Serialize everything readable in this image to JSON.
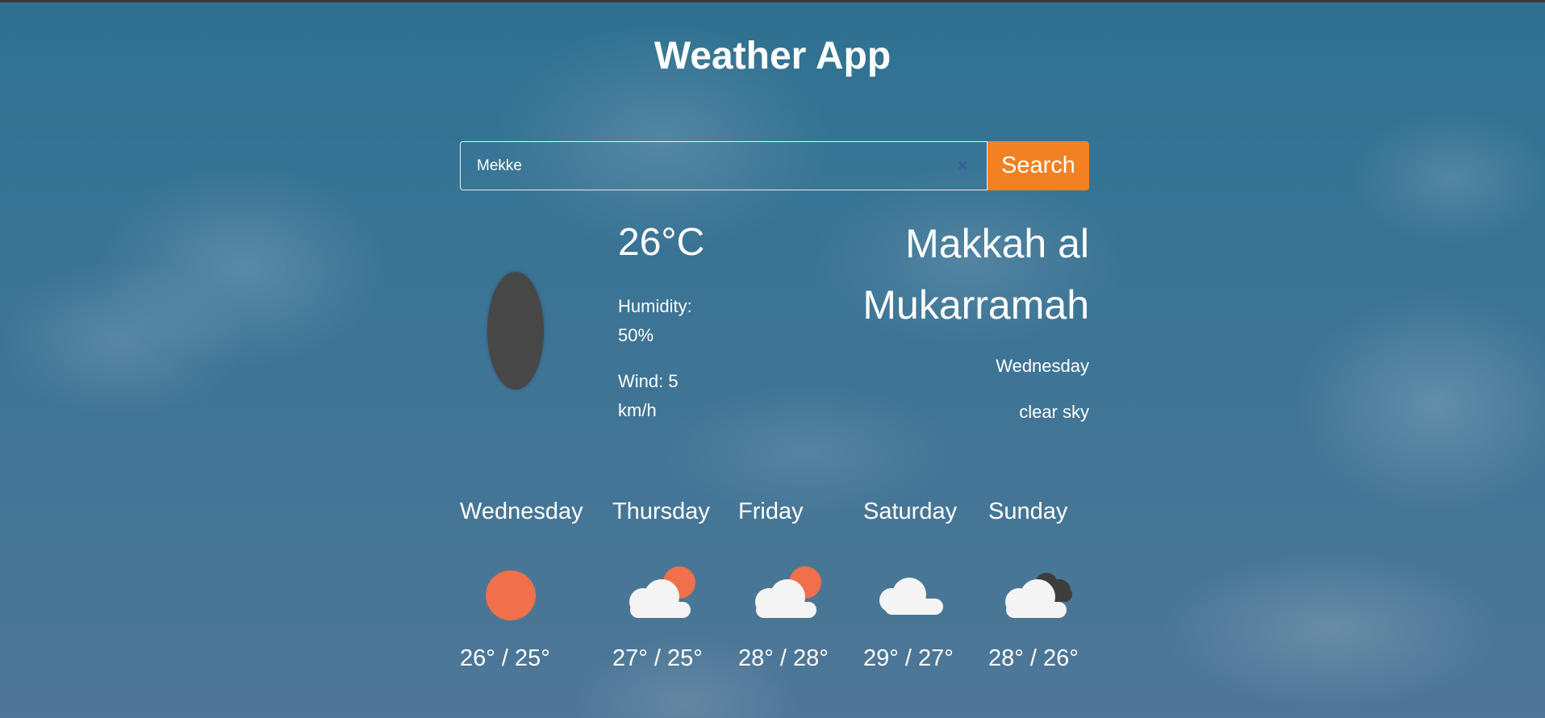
{
  "app": {
    "title": "Weather App"
  },
  "search": {
    "value": "Mekke",
    "button_label": "Search"
  },
  "current": {
    "temperature": "26°C",
    "humidity_label": "Humidity:",
    "humidity_value": "50%",
    "wind_label": "Wind: 5",
    "wind_unit": "km/h",
    "city_line1": "Makkah al",
    "city_line2": "Mukarramah",
    "day": "Wednesday",
    "description": "clear sky",
    "icon": "moon-icon"
  },
  "forecast": [
    {
      "day": "Wednesday",
      "icon": "sun-icon",
      "temps": "26° / 25°"
    },
    {
      "day": "Thursday",
      "icon": "cloud-sun-icon",
      "temps": "27° / 25°"
    },
    {
      "day": "Friday",
      "icon": "cloud-sun-icon",
      "temps": "28° / 28°"
    },
    {
      "day": "Saturday",
      "icon": "cloud-icon",
      "temps": "29° / 27°"
    },
    {
      "day": "Sunday",
      "icon": "cloud-dark-icon",
      "temps": "28° / 26°"
    }
  ],
  "colors": {
    "accent": "#f28124",
    "sun": "#f0704a",
    "cloud": "#f4f4f4",
    "dark_cloud": "#3d3d3d",
    "moon": "#474747"
  }
}
